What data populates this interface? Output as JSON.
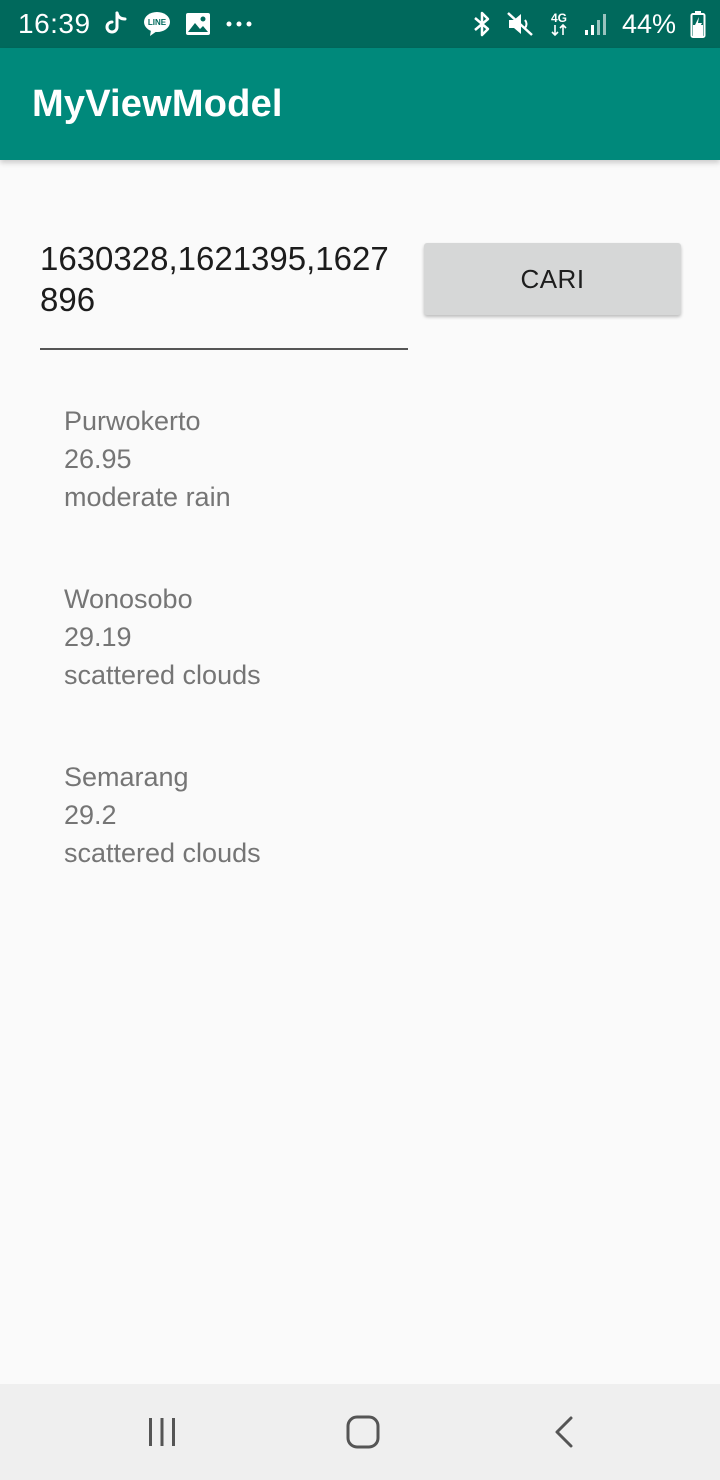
{
  "status_bar": {
    "time": "16:39",
    "battery": "44%",
    "left_icons": [
      "tiktok-icon",
      "line-icon",
      "gallery-icon",
      "more-icon"
    ],
    "right_icons": [
      "bluetooth-icon",
      "mute-icon",
      "network-4g-icon",
      "signal-icon",
      "battery-icon"
    ],
    "background": "#00695c"
  },
  "app_bar": {
    "title": "MyViewModel",
    "background": "#00897b"
  },
  "search": {
    "value": "1630328,1621395,1627896",
    "button_label": "CARI"
  },
  "results": [
    {
      "city": "Purwokerto",
      "temp": "26.95",
      "description": "moderate rain"
    },
    {
      "city": "Wonosobo",
      "temp": "29.19",
      "description": "scattered clouds"
    },
    {
      "city": "Semarang",
      "temp": "29.2",
      "description": "scattered clouds"
    }
  ],
  "nav_bar": {
    "icons": [
      "recent-apps-icon",
      "home-icon",
      "back-icon"
    ]
  }
}
